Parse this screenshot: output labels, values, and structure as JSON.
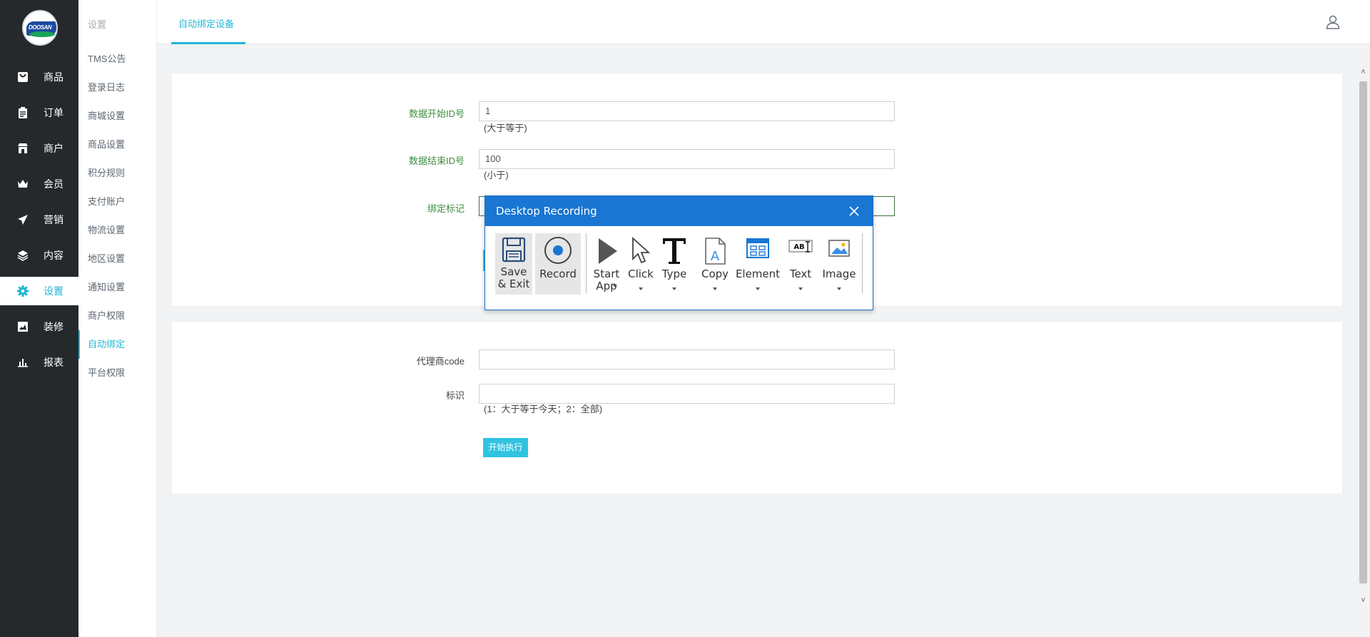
{
  "colors": {
    "accent": "#22b7d6",
    "sidebar_bg": "#26292c",
    "dialog_blue": "#1976d2",
    "label_green": "#3e8c3e"
  },
  "logo": {
    "text": "DOOSAN"
  },
  "sidebar": {
    "items": [
      {
        "label": "商品",
        "icon": "bag-icon"
      },
      {
        "label": "订单",
        "icon": "clipboard-icon"
      },
      {
        "label": "商户",
        "icon": "store-icon"
      },
      {
        "label": "会员",
        "icon": "crown-icon"
      },
      {
        "label": "营销",
        "icon": "paper-plane-icon"
      },
      {
        "label": "内容",
        "icon": "layers-icon"
      },
      {
        "label": "设置",
        "icon": "gear-icon",
        "active": true
      },
      {
        "label": "装修",
        "icon": "image-icon"
      },
      {
        "label": "报表",
        "icon": "bar-chart-icon"
      }
    ]
  },
  "subnav": {
    "heading": "设置",
    "items": [
      "TMS公告",
      "登录日志",
      "商城设置",
      "商品设置",
      "积分规则",
      "支付账户",
      "物流设置",
      "地区设置",
      "通知设置",
      "商户权限",
      "自动绑定",
      "平台权限"
    ],
    "active_index": 10
  },
  "header": {
    "tab": "自动绑定设备",
    "user_icon": "user-icon"
  },
  "form1": {
    "start_id": {
      "label": "数据开始ID号",
      "value": "1",
      "hint": "(大于等于)"
    },
    "end_id": {
      "label": "数据结束ID号",
      "value": "100",
      "hint": "(小于)"
    },
    "bind_flag": {
      "label": "绑定标记",
      "value": ""
    }
  },
  "form2": {
    "agent_code": {
      "label": "代理商code",
      "value": ""
    },
    "flag": {
      "label": "标识",
      "value": "",
      "hint": "(1：大于等于今天；2：全部)"
    },
    "run_button": "开始执行"
  },
  "dialog": {
    "title": "Desktop Recording",
    "tools": [
      {
        "label": "Save\n& Exit",
        "icon": "floppy-disk-icon"
      },
      {
        "label": "Record",
        "icon": "record-icon"
      },
      {
        "label": "Start\nApp",
        "icon": "play-icon"
      },
      {
        "label": "Click",
        "icon": "cursor-icon"
      },
      {
        "label": "Type",
        "icon": "type-t-icon"
      },
      {
        "label": "Copy",
        "icon": "copy-document-icon"
      },
      {
        "label": "Element",
        "icon": "window-element-icon"
      },
      {
        "label": "Text",
        "icon": "text-select-icon"
      },
      {
        "label": "Image",
        "icon": "picture-icon"
      }
    ]
  }
}
